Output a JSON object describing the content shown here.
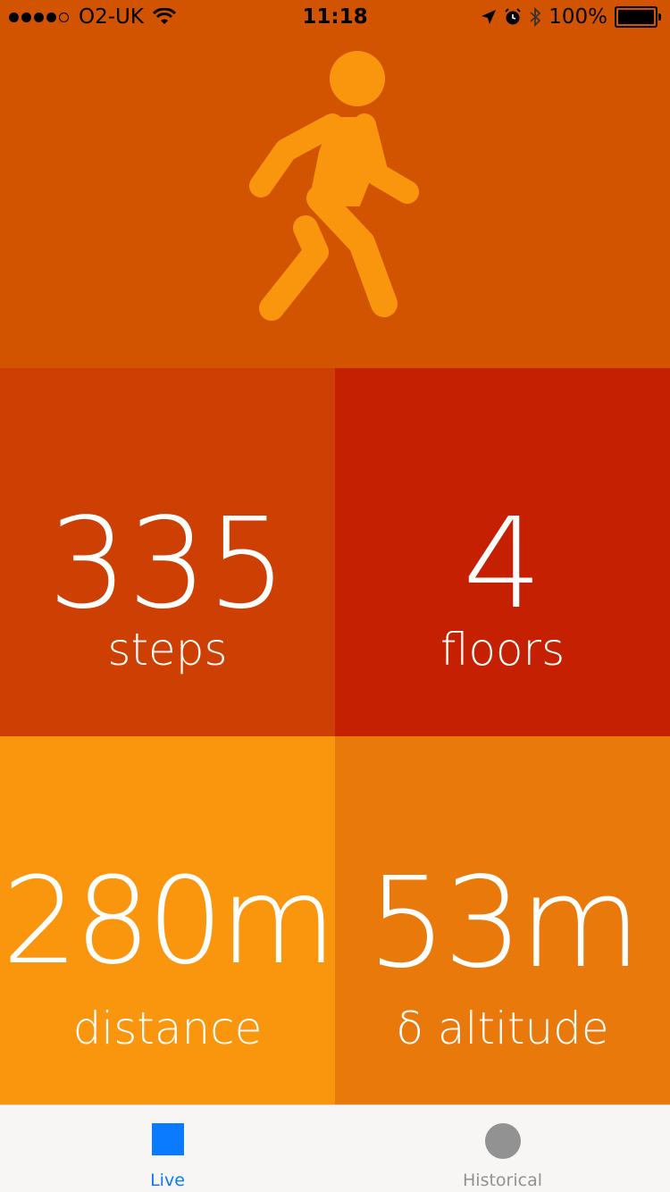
{
  "status_bar": {
    "carrier": "O2-UK",
    "time": "11:18",
    "battery": "100%"
  },
  "hero": {
    "icon": "walking-person-icon",
    "color": "#fa960d",
    "background": "#d35400"
  },
  "tiles": {
    "steps": {
      "value": "335",
      "label": "steps",
      "color": "#cd3f02"
    },
    "floors": {
      "value": "4",
      "label": "floors",
      "color": "#c52002"
    },
    "distance": {
      "value": "280m",
      "label": "distance",
      "color": "#fa960d"
    },
    "altitude": {
      "value": "53m",
      "label": "δ altitude",
      "color": "#e9790a"
    }
  },
  "tab_bar": {
    "tabs": [
      {
        "label": "Live",
        "icon": "square-icon",
        "active": true,
        "color": "#0a7aff"
      },
      {
        "label": "Historical",
        "icon": "circle-icon",
        "active": false,
        "color": "#929292"
      }
    ]
  }
}
